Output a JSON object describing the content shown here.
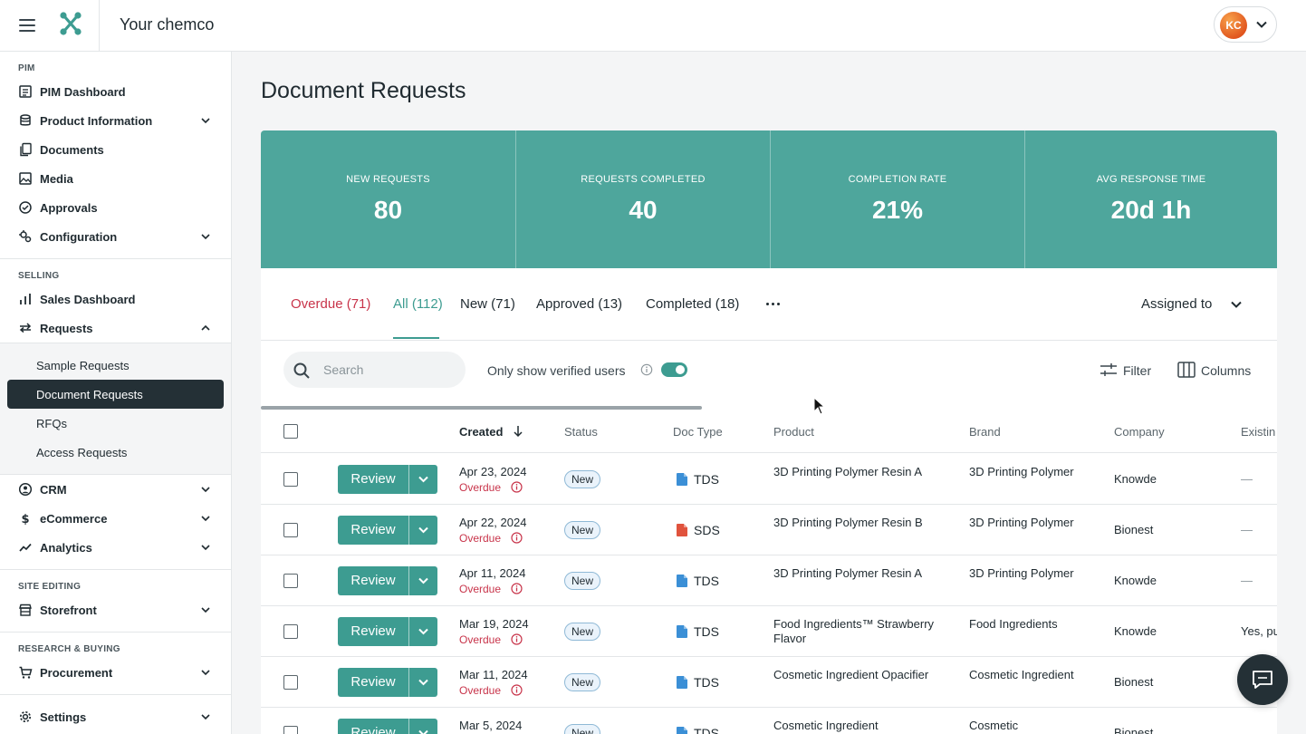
{
  "header": {
    "company_name": "Your chemco",
    "user_initials": "KC"
  },
  "sidebar": {
    "sections": [
      "PIM",
      "SELLING",
      "SITE EDITING",
      "RESEARCH & BUYING"
    ],
    "items": [
      {
        "label": "PIM Dashboard",
        "icon": "list-icon"
      },
      {
        "label": "Product Information",
        "icon": "database-icon"
      },
      {
        "label": "Documents",
        "icon": "documents-icon"
      },
      {
        "label": "Media",
        "icon": "image-icon"
      },
      {
        "label": "Approvals",
        "icon": "check-circle-icon"
      },
      {
        "label": "Configuration",
        "icon": "config-icon"
      },
      {
        "label": "Sales Dashboard",
        "icon": "bar-chart-icon"
      },
      {
        "label": "Requests",
        "icon": "arrows-icon"
      },
      {
        "label": "CRM",
        "icon": "user-circle-icon"
      },
      {
        "label": "eCommerce",
        "icon": "dollar-icon"
      },
      {
        "label": "Analytics",
        "icon": "trend-icon"
      },
      {
        "label": "Storefront",
        "icon": "store-icon"
      },
      {
        "label": "Procurement",
        "icon": "cart-icon"
      },
      {
        "label": "Settings",
        "icon": "gear-icon"
      }
    ],
    "subitems": [
      "Sample Requests",
      "Document Requests",
      "RFQs",
      "Access Requests"
    ],
    "active_subitem": "Document Requests"
  },
  "page": {
    "title": "Document Requests"
  },
  "stats": [
    {
      "label": "NEW REQUESTS",
      "value": "80"
    },
    {
      "label": "REQUESTS COMPLETED",
      "value": "40"
    },
    {
      "label": "COMPLETION RATE",
      "value": "21%"
    },
    {
      "label": "AVG RESPONSE TIME",
      "value": "20d 1h"
    }
  ],
  "tabs": [
    "Overdue (71)",
    "All (112)",
    "New (71)",
    "Approved (13)",
    "Completed (18)"
  ],
  "active_tab": "All (112)",
  "assigned_to": "Assigned to",
  "toolbar": {
    "search_placeholder": "Search",
    "verified_label": "Only show verified users",
    "verified_on": true,
    "filter_label": "Filter",
    "columns_label": "Columns"
  },
  "table": {
    "columns": [
      "Created",
      "Status",
      "Doc Type",
      "Product",
      "Brand",
      "Company",
      "Existin"
    ],
    "review_label": "Review",
    "rows": [
      {
        "date": "Apr 23, 2024",
        "overdue": "Overdue",
        "status": "New",
        "doc_type": "TDS",
        "doc_color": "#3b8fd6",
        "product": "3D Printing Polymer Resin A",
        "brand": "3D Printing Polymer",
        "company": "Knowde",
        "existing": "—"
      },
      {
        "date": "Apr 22, 2024",
        "overdue": "Overdue",
        "status": "New",
        "doc_type": "SDS",
        "doc_color": "#e0533d",
        "product": "3D Printing Polymer Resin B",
        "brand": "3D Printing Polymer",
        "company": "Bionest",
        "existing": "—"
      },
      {
        "date": "Apr 11, 2024",
        "overdue": "Overdue",
        "status": "New",
        "doc_type": "TDS",
        "doc_color": "#3b8fd6",
        "product": "3D Printing Polymer Resin A",
        "brand": "3D Printing Polymer",
        "company": "Knowde",
        "existing": "—"
      },
      {
        "date": "Mar 19, 2024",
        "overdue": "Overdue",
        "status": "New",
        "doc_type": "TDS",
        "doc_color": "#3b8fd6",
        "product": "Food Ingredients™ Strawberry Flavor",
        "brand": "Food Ingredients",
        "company": "Knowde",
        "existing": "Yes, pu"
      },
      {
        "date": "Mar 11, 2024",
        "overdue": "Overdue",
        "status": "New",
        "doc_type": "TDS",
        "doc_color": "#3b8fd6",
        "product": "Cosmetic Ingredient Opacifier",
        "brand": "Cosmetic Ingredient",
        "company": "Bionest",
        "existing": ""
      },
      {
        "date": "Mar 5, 2024",
        "overdue": "",
        "status": "New",
        "doc_type": "TDS",
        "doc_color": "#3b8fd6",
        "product": "Cosmetic Ingredient",
        "brand": "Cosmetic",
        "company": "Bionest",
        "existing": ""
      }
    ]
  },
  "colors": {
    "accent": "#3d9c91",
    "stats_bg": "#4ea69c",
    "overdue": "#c8344a",
    "sidebar_active": "#243036"
  }
}
